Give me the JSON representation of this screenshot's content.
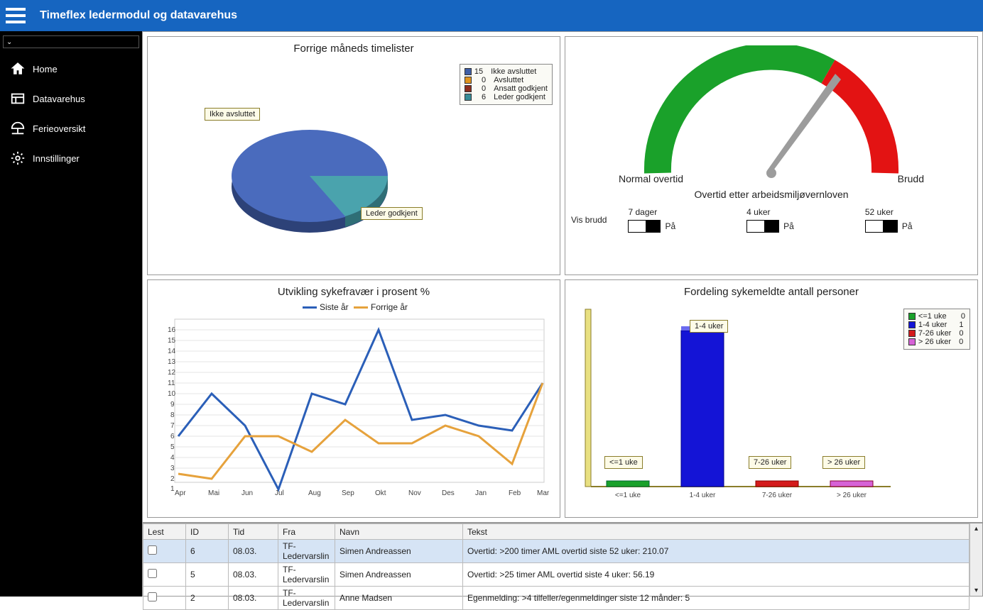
{
  "header": {
    "title": "Timeflex ledermodul og datavarehus"
  },
  "sidebar": {
    "items": [
      {
        "label": "Home"
      },
      {
        "label": "Datavarehus"
      },
      {
        "label": "Ferieoversikt"
      },
      {
        "label": "Innstillinger"
      }
    ]
  },
  "pie": {
    "title": "Forrige måneds timelister",
    "legend": [
      {
        "count": "15",
        "label": "Ikke avsluttet",
        "color": "#3f5fa6"
      },
      {
        "count": "0",
        "label": "Avsluttet",
        "color": "#e0941d"
      },
      {
        "count": "0",
        "label": "Ansatt godkjent",
        "color": "#8c2d1e"
      },
      {
        "count": "6",
        "label": "Leder godkjent",
        "color": "#378c97"
      }
    ],
    "callout1": "Ikke avsluttet",
    "callout2": "Leder godkjent"
  },
  "gauge": {
    "left": "Normal overtid",
    "right": "Brudd",
    "caption": "Overtid etter arbeidsmiljøvernloven",
    "vis_label": "Vis brudd",
    "toggles": [
      {
        "title": "7 dager",
        "state": "På"
      },
      {
        "title": "4 uker",
        "state": "På"
      },
      {
        "title": "52 uker",
        "state": "På"
      }
    ]
  },
  "line": {
    "title": "Utvikling sykefravær i prosent %",
    "series1_name": "Siste år",
    "series2_name": "Forrige år"
  },
  "bar": {
    "title": "Fordeling sykemeldte antall personer",
    "highlight": "1-4 uker",
    "legend": [
      {
        "label": "<=1 uke",
        "count": "0",
        "color": "#1aa12a"
      },
      {
        "label": "1-4 uker",
        "count": "1",
        "color": "#1414d6"
      },
      {
        "label": "7-26 uker",
        "count": "0",
        "color": "#d41b1b"
      },
      {
        "label": "> 26 uker",
        "count": "0",
        "color": "#d662d6"
      }
    ]
  },
  "table": {
    "headers": {
      "lest": "Lest",
      "id": "ID",
      "tid": "Tid",
      "fra": "Fra",
      "navn": "Navn",
      "tekst": "Tekst"
    },
    "rows": [
      {
        "id": "6",
        "tid": "08.03.",
        "fra": "TF-Ledervarslin",
        "navn": "Simen Andreassen",
        "tekst": "Overtid: >200 timer AML overtid siste 52 uker: 210.07"
      },
      {
        "id": "5",
        "tid": "08.03.",
        "fra": "TF-Ledervarslin",
        "navn": "Simen Andreassen",
        "tekst": "Overtid: >25 timer AML overtid siste 4 uker: 56.19"
      },
      {
        "id": "2",
        "tid": "08.03.",
        "fra": "TF-Ledervarslin",
        "navn": "Anne Madsen",
        "tekst": "Egenmelding: >4 tilfeller/egenmeldinger siste 12 månder: 5"
      }
    ]
  },
  "chart_data": [
    {
      "type": "pie",
      "title": "Forrige måneds timelister",
      "series": [
        {
          "name": "Ikke avsluttet",
          "value": 15
        },
        {
          "name": "Avsluttet",
          "value": 0
        },
        {
          "name": "Ansatt godkjent",
          "value": 0
        },
        {
          "name": "Leder godkjent",
          "value": 6
        }
      ]
    },
    {
      "type": "line",
      "title": "Utvikling sykefravær i prosent %",
      "categories": [
        "Apr",
        "Mai",
        "Jun",
        "Jul",
        "Aug",
        "Sep",
        "Okt",
        "Nov",
        "Des",
        "Jan",
        "Feb",
        "Mar"
      ],
      "series": [
        {
          "name": "Siste år",
          "values": [
            6,
            10,
            7,
            1,
            10,
            9,
            16,
            7.5,
            8,
            7,
            6.5,
            11
          ]
        },
        {
          "name": "Forrige år",
          "values": [
            2.5,
            2,
            6,
            6,
            4.5,
            7.5,
            5.5,
            5.5,
            7,
            6,
            3.5,
            11
          ]
        }
      ],
      "ylabel": "%",
      "ylim": [
        1,
        16
      ]
    },
    {
      "type": "bar",
      "title": "Fordeling sykemeldte antall personer",
      "categories": [
        "<=1 uke",
        "1-4 uker",
        "7-26 uker",
        "> 26 uker"
      ],
      "values": [
        0,
        1,
        0,
        0
      ]
    }
  ]
}
